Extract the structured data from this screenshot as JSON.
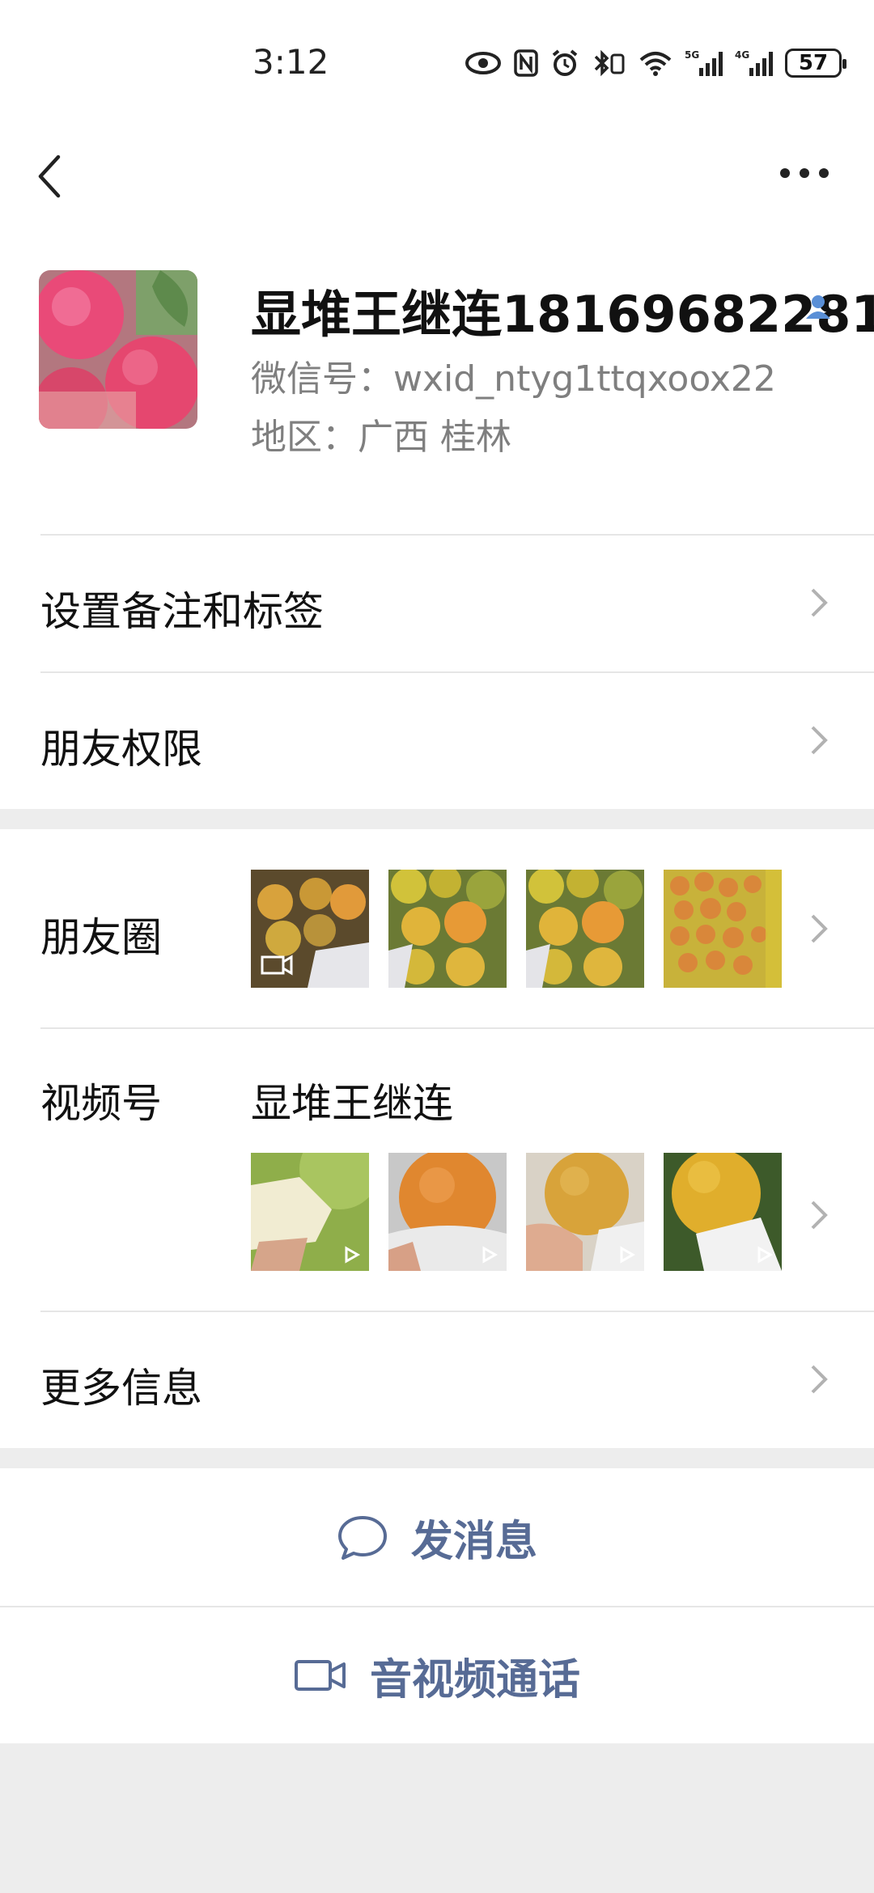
{
  "status_bar": {
    "time": "3:12",
    "battery": "57",
    "icons": [
      "eye-icon",
      "nfc-icon",
      "alarm-icon",
      "bluetooth-icon",
      "wifi-icon",
      "signal-5g-icon",
      "signal-4g-icon",
      "battery-icon"
    ]
  },
  "nav": {
    "back_icon": "back-icon",
    "more_icon": "more-icon"
  },
  "profile": {
    "name": "显堆王继连18169682281",
    "wechat_id": "微信号：wxid_ntyg1ttqxoox22",
    "region": "地区：广西  桂林"
  },
  "rows": {
    "remark": "设置备注和标签",
    "permission": "朋友权限",
    "moments": "朋友圈",
    "channels": "视频号",
    "channels_name": "显堆王继连",
    "more_info": "更多信息"
  },
  "actions": {
    "message": "发消息",
    "call": "音视频通话"
  },
  "colors": {
    "link_blue": "#576b95",
    "page_bg": "#ededed",
    "secondary_text": "#7f7f7f"
  }
}
